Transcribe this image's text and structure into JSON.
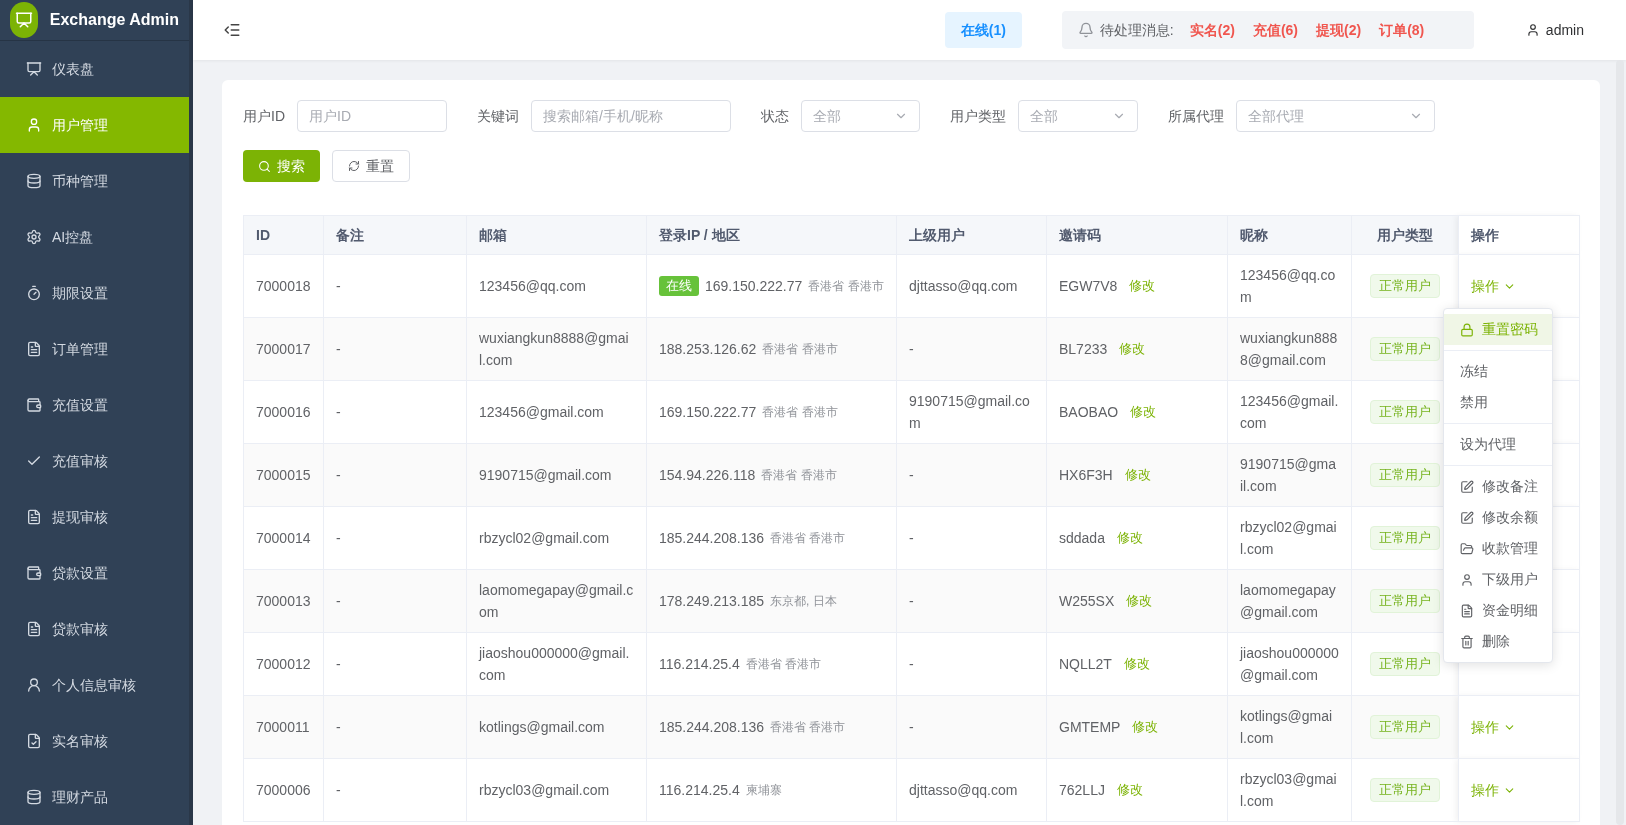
{
  "sidebar": {
    "title": "Exchange Admin",
    "items": [
      {
        "label": "仪表盘",
        "selected": false
      },
      {
        "label": "用户管理",
        "selected": true
      },
      {
        "label": "币种管理",
        "selected": false
      },
      {
        "label": "AI控盘",
        "selected": false
      },
      {
        "label": "期限设置",
        "selected": false
      },
      {
        "label": "订单管理",
        "selected": false
      },
      {
        "label": "充值设置",
        "selected": false
      },
      {
        "label": "充值审核",
        "selected": false
      },
      {
        "label": "提现审核",
        "selected": false
      },
      {
        "label": "贷款设置",
        "selected": false
      },
      {
        "label": "贷款审核",
        "selected": false
      },
      {
        "label": "个人信息审核",
        "selected": false
      },
      {
        "label": "实名审核",
        "selected": false
      },
      {
        "label": "理财产品",
        "selected": false
      }
    ]
  },
  "header": {
    "online": "在线(1)",
    "notice_label": "待处理消息:",
    "notices": [
      "实名(2)",
      "充值(6)",
      "提现(2)",
      "订单(8)"
    ],
    "user": "admin"
  },
  "filters": [
    {
      "kind": "input",
      "label": "用户ID",
      "placeholder": "用户ID"
    },
    {
      "kind": "input",
      "label": "关键词",
      "placeholder": "搜索邮箱/手机/昵称"
    },
    {
      "kind": "select",
      "label": "状态",
      "placeholder": "全部"
    },
    {
      "kind": "select",
      "label": "用户类型",
      "placeholder": "全部"
    },
    {
      "kind": "select",
      "label": "所属代理",
      "placeholder": "全部代理"
    }
  ],
  "buttons": [
    {
      "kind": "primary",
      "label": "搜索"
    },
    {
      "kind": "default",
      "label": "重置"
    }
  ],
  "table": {
    "columns": [
      "ID",
      "备注",
      "邮箱",
      "登录IP / 地区",
      "上级用户",
      "邀请码",
      "昵称",
      "用户类型",
      "操作"
    ],
    "rows": [
      {
        "id": "7000018",
        "note": "-",
        "email": "123456@qq.com",
        "status": "在线",
        "ip": "169.150.222.77",
        "region": "香港省 香港市",
        "parent": "djttasso@qq.com",
        "invite_code": "EGW7V8",
        "edit": "修改",
        "nickname": "123456@qq.com",
        "user_type": "正常用户",
        "action": "操作"
      },
      {
        "id": "7000017",
        "note": "-",
        "email": "wuxiangkun8888@gmail.com",
        "ip": "188.253.126.62",
        "region": "香港省 香港市",
        "parent": "-",
        "invite_code": "BL7233",
        "edit": "修改",
        "nickname": "wuxiangkun8888@gmail.com",
        "user_type": "正常用户"
      },
      {
        "id": "7000016",
        "note": "-",
        "email": "123456@gmail.com",
        "ip": "169.150.222.77",
        "region": "香港省 香港市",
        "parent": "9190715@gmail.com",
        "invite_code": "BAOBAO",
        "edit": "修改",
        "nickname": "123456@gmail.com",
        "user_type": "正常用户"
      },
      {
        "id": "7000015",
        "note": "-",
        "email": "9190715@gmail.com",
        "ip": "154.94.226.118",
        "region": "香港省 香港市",
        "parent": "-",
        "invite_code": "HX6F3H",
        "edit": "修改",
        "nickname": "9190715@gmail.com",
        "user_type": "正常用户"
      },
      {
        "id": "7000014",
        "note": "-",
        "email": "rbzycl02@gmail.com",
        "ip": "185.244.208.136",
        "region": "香港省 香港市",
        "parent": "-",
        "invite_code": "sddada",
        "edit": "修改",
        "nickname": "rbzycl02@gmail.com",
        "user_type": "正常用户"
      },
      {
        "id": "7000013",
        "note": "-",
        "email": "laomomegapay@gmail.com",
        "ip": "178.249.213.185",
        "region": "东京都, 日本",
        "parent": "-",
        "invite_code": "W255SX",
        "edit": "修改",
        "nickname": "laomomegapay@gmail.com",
        "user_type": "正常用户"
      },
      {
        "id": "7000012",
        "note": "-",
        "email": "jiaoshou000000@gmail.com",
        "ip": "116.214.25.4",
        "region": "香港省 香港市",
        "parent": "-",
        "invite_code": "NQLL2T",
        "edit": "修改",
        "nickname": "jiaoshou000000@gmail.com",
        "user_type": "正常用户"
      },
      {
        "id": "7000011",
        "note": "-",
        "email": "kotlings@gmail.com",
        "ip": "185.244.208.136",
        "region": "香港省 香港市",
        "parent": "-",
        "invite_code": "GMTEMP",
        "edit": "修改",
        "nickname": "kotlings@gmail.com",
        "user_type": "正常用户",
        "action": "操作"
      },
      {
        "id": "7000006",
        "note": "-",
        "email": "rbzycl03@gmail.com",
        "ip": "116.214.25.4",
        "region": "柬埔寨",
        "parent": "djttasso@qq.com",
        "invite_code": "762LLJ",
        "edit": "修改",
        "nickname": "rbzycl03@gmail.com",
        "user_type": "正常用户",
        "action": "操作"
      }
    ]
  },
  "action_menu": {
    "groups": [
      [
        {
          "kind": "lock",
          "label": "重置密码",
          "selected": true
        }
      ],
      [
        {
          "kind": "plain",
          "label": "冻结",
          "selected": false
        },
        {
          "kind": "plain",
          "label": "禁用",
          "selected": false
        }
      ],
      [
        {
          "kind": "plain",
          "label": "设为代理",
          "selected": false
        }
      ],
      [
        {
          "kind": "edit",
          "label": "修改备注",
          "selected": false
        },
        {
          "kind": "edit",
          "label": "修改余额",
          "selected": false
        },
        {
          "kind": "folder",
          "label": "收款管理",
          "selected": false
        },
        {
          "kind": "user",
          "label": "下级用户",
          "selected": false
        },
        {
          "kind": "file",
          "label": "资金明细",
          "selected": false
        },
        {
          "kind": "trash",
          "label": "删除",
          "selected": false
        }
      ]
    ]
  }
}
